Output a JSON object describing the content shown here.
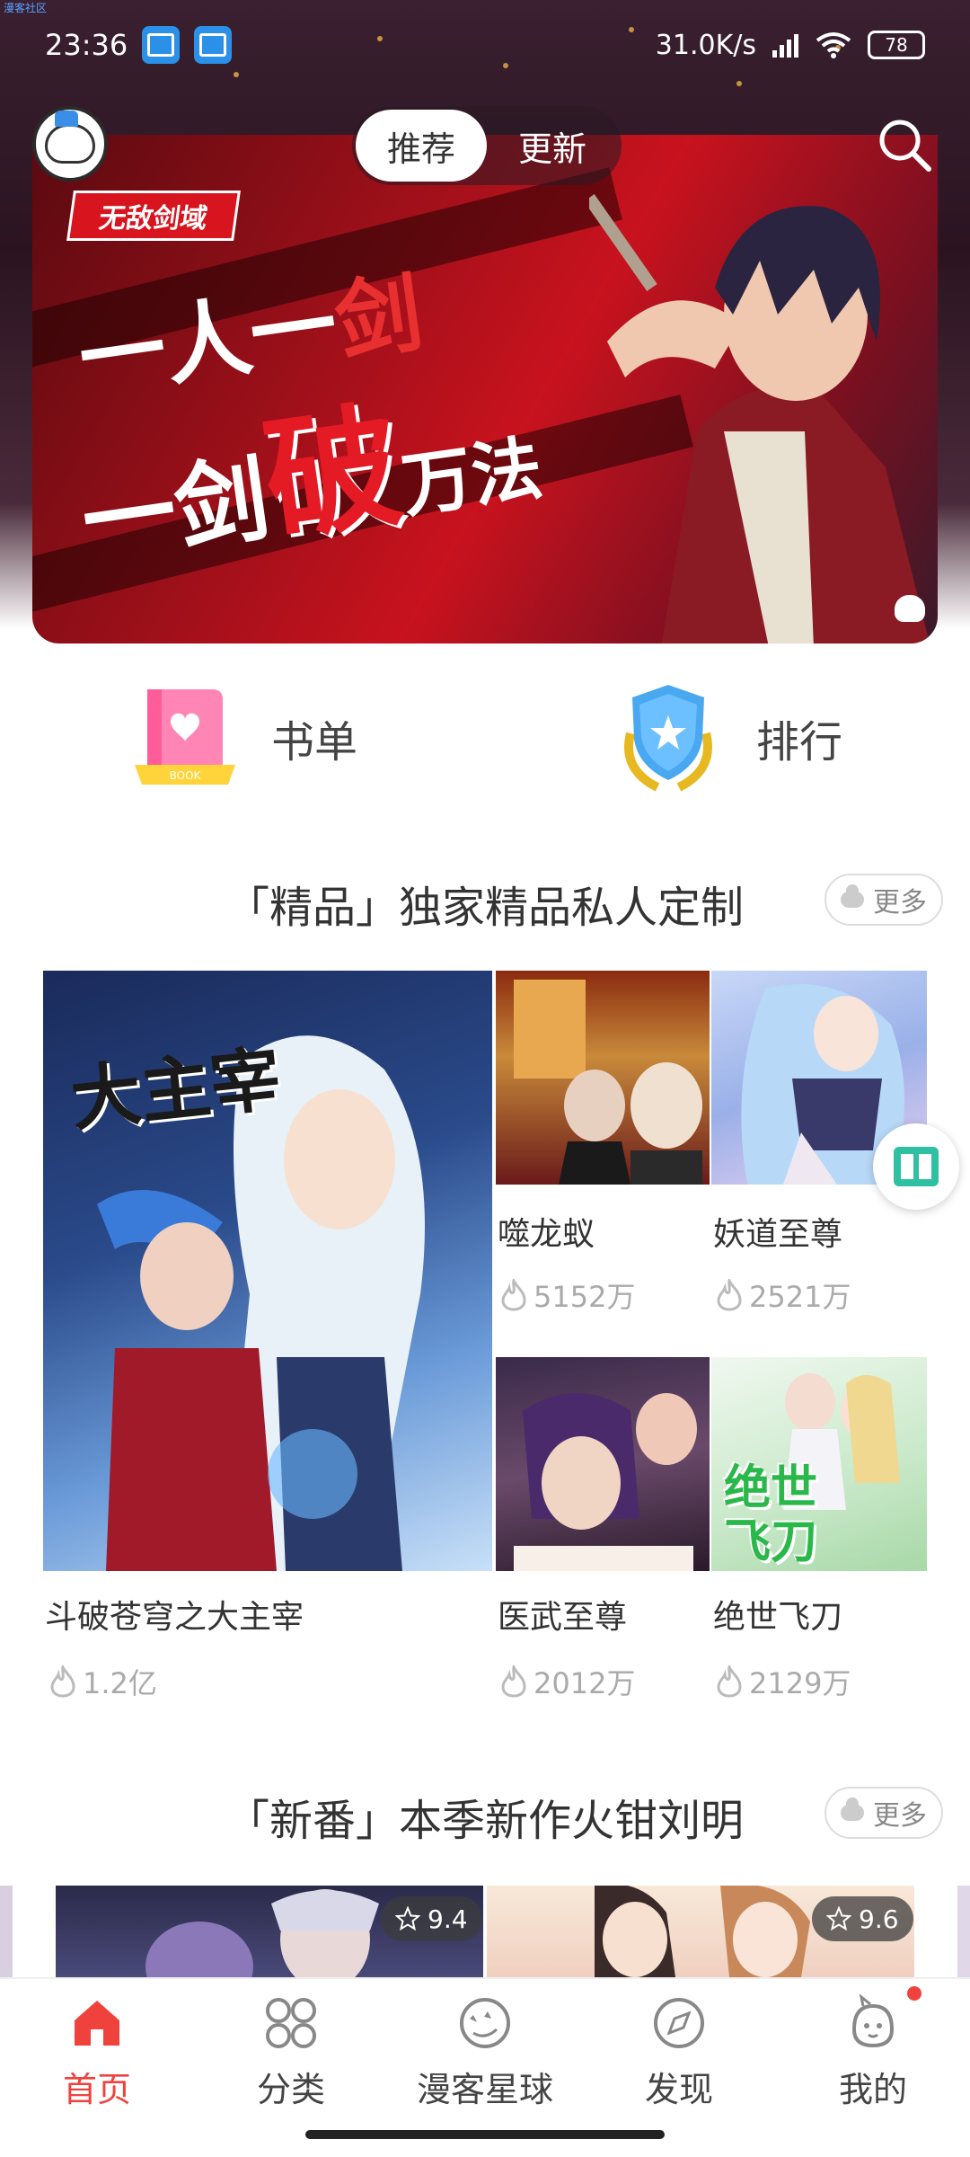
{
  "status_bar": {
    "corner_text": "漫客社区",
    "time": "23:36",
    "speed": "31.0K/s",
    "battery": "78"
  },
  "header": {
    "tabs": [
      {
        "label": "推荐",
        "active": true
      },
      {
        "label": "更新",
        "active": false
      }
    ]
  },
  "banner": {
    "tag": "无敌剑域",
    "line1": "一人一",
    "line1_red": "剑",
    "line2_a": "一剑",
    "line2_hl": "破",
    "line2_b": "万法"
  },
  "shortcuts": [
    {
      "label": "书单",
      "icon": "book-icon"
    },
    {
      "label": "排行",
      "icon": "medal-icon"
    }
  ],
  "section1": {
    "title": "「精品」独家精品私人定制",
    "more": "更多",
    "items": [
      {
        "title": "斗破苍穹之大主宰",
        "heat": "1.2亿",
        "cover_text": "大主宰"
      },
      {
        "title": "噬龙蚁",
        "heat": "5152万"
      },
      {
        "title": "妖道至尊",
        "heat": "2521万"
      },
      {
        "title": "医武至尊",
        "heat": "2012万"
      },
      {
        "title": "绝世飞刀",
        "heat": "2129万",
        "cover_text": "绝世飞刀"
      }
    ]
  },
  "section2": {
    "title": "「新番」本季新作火钳刘明",
    "more": "更多",
    "items": [
      {
        "rating": "9.4"
      },
      {
        "rating": "9.6"
      }
    ]
  },
  "tabbar": {
    "items": [
      {
        "label": "首页",
        "icon": "home-icon",
        "active": true
      },
      {
        "label": "分类",
        "icon": "category-icon",
        "active": false
      },
      {
        "label": "漫客星球",
        "icon": "planet-icon",
        "active": false
      },
      {
        "label": "发现",
        "icon": "compass-icon",
        "active": false
      },
      {
        "label": "我的",
        "icon": "profile-icon",
        "active": false
      }
    ]
  },
  "colors": {
    "accent": "#f0423c",
    "banner_red": "#c8121e"
  }
}
